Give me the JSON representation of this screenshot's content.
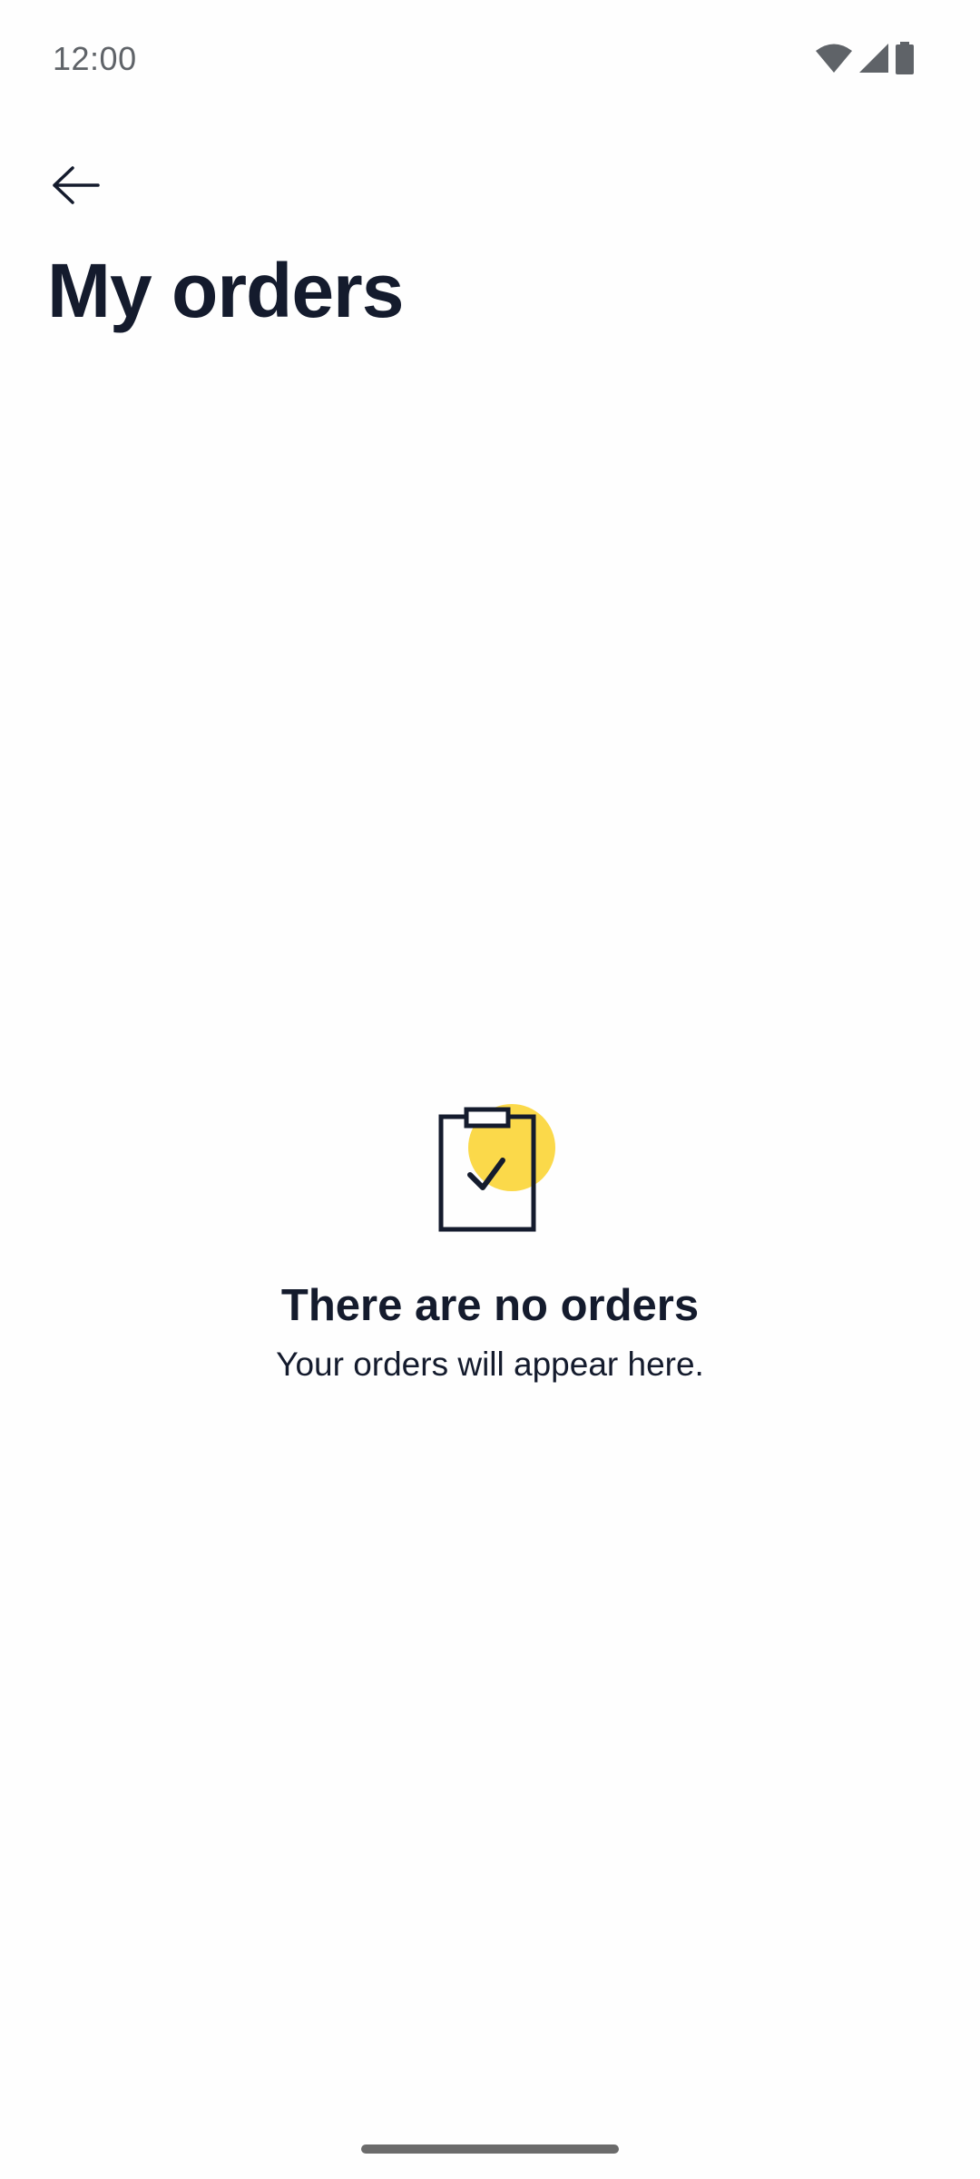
{
  "status_bar": {
    "time": "12:00",
    "icons": [
      "wifi-icon",
      "cellular-signal-icon",
      "battery-icon"
    ]
  },
  "header": {
    "back_icon": "arrow-left-icon",
    "title": "My orders"
  },
  "empty_state": {
    "icon": "clipboard-check-icon",
    "title": "There are no orders",
    "subtitle": "Your orders will appear here."
  },
  "colors": {
    "text_primary": "#141b2d",
    "accent_yellow": "#fbd94a",
    "background": "#fefefe",
    "status_text": "#5f6368"
  }
}
